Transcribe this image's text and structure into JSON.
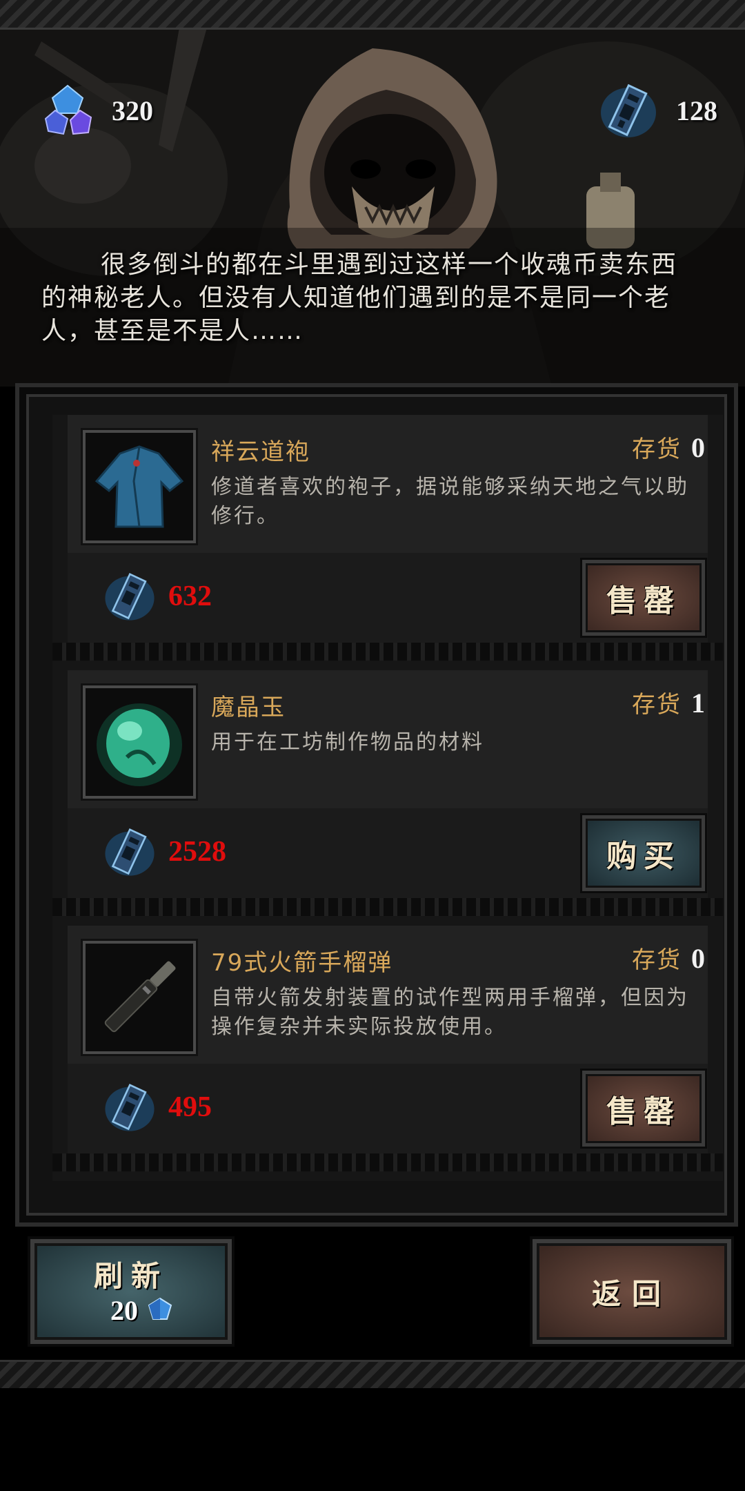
{
  "header": {
    "gem_currency": {
      "icon": "blue-gem-icon",
      "value": "320"
    },
    "soul_coin_currency": {
      "icon": "soul-coin-icon",
      "value": "128"
    },
    "story_text": "很多倒斗的都在斗里遇到过这样一个收魂币卖东西的神秘老人。但没有人知道他们遇到的是不是同一个老人，甚至是不是人……"
  },
  "shop": {
    "items": [
      {
        "name": "祥云道袍",
        "stock_label": "存货",
        "stock": "0",
        "description": "修道者喜欢的袍子，据说能够采纳天地之气以助修行。",
        "price": "632",
        "action_label": "售罄",
        "action_type": "sold-out",
        "thumb_icon": "blue-robe-icon"
      },
      {
        "name": "魔晶玉",
        "stock_label": "存货",
        "stock": "1",
        "description": "用于在工坊制作物品的材料",
        "price": "2528",
        "action_label": "购买",
        "action_type": "buy",
        "thumb_icon": "green-jade-icon"
      },
      {
        "name": "79式火箭手榴弹",
        "stock_label": "存货",
        "stock": "0",
        "description": "自带火箭发射装置的试作型两用手榴弹，但因为操作复杂并未实际投放使用。",
        "price": "495",
        "action_label": "售罄",
        "action_type": "sold-out",
        "thumb_icon": "rocket-grenade-icon"
      }
    ]
  },
  "controls": {
    "refresh_label": "刷新",
    "refresh_cost": "20",
    "back_label": "返回"
  },
  "colors": {
    "item_name": "#d9a85a",
    "price": "#e00d0d",
    "sell_button": "#5a3d33",
    "buy_button": "#34505a"
  }
}
